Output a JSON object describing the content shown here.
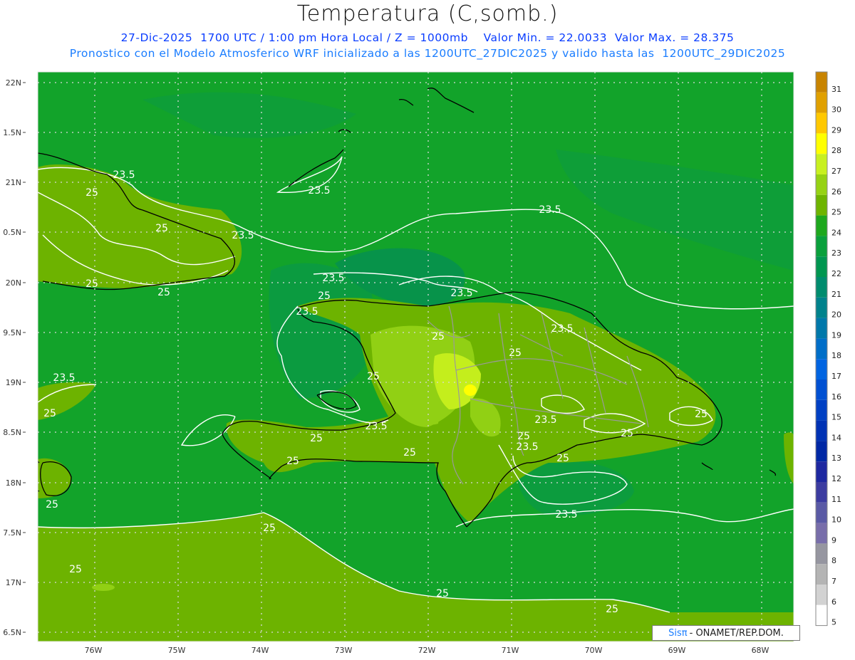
{
  "header": {
    "title": "Temperatura (C,somb.)",
    "subtitle_line1": "27-Dic-2025  1700 UTC / 1:00 pm Hora Local / Z = 1000mb    Valor Min. = 22.0033  Valor Max. = 28.375",
    "subtitle_line2": "Pronostico con el Modelo Atmosferico WRF inicializado a las 1200UTC_27DIC2025 y valido hasta las  1200UTC_29DIC2025"
  },
  "map": {
    "lat_labels": [
      "22N",
      "1.5N",
      "21N",
      "0.5N",
      "20N",
      "9.5N",
      "19N",
      "8.5N",
      "18N",
      "7.5N",
      "17N",
      "6.5N"
    ],
    "lon_labels": [
      "76W",
      "75W",
      "74W",
      "73W",
      "72W",
      "71W",
      "70W",
      "69W",
      "68W"
    ],
    "contour_labels": [
      {
        "text": "23.5",
        "id": "north-cuba"
      },
      {
        "text": "25",
        "id": "cuba-west"
      },
      {
        "text": "25",
        "id": "cuba-mid"
      },
      {
        "text": "23.5",
        "id": "cuba-east"
      },
      {
        "text": "25",
        "id": "cuba-south-1"
      },
      {
        "text": "25",
        "id": "cuba-south-2"
      },
      {
        "text": "23.5",
        "id": "great-inagua"
      },
      {
        "text": "23.5",
        "id": "atlantic-northeast"
      },
      {
        "text": "23.5",
        "id": "tortuga"
      },
      {
        "text": "25",
        "id": "nw-haiti"
      },
      {
        "text": "23.5",
        "id": "haiti-gulf-north"
      },
      {
        "text": "23.5",
        "id": "dr-north-coast"
      },
      {
        "text": "25",
        "id": "haiti-central"
      },
      {
        "text": "25",
        "id": "dr-cordillera"
      },
      {
        "text": "23.5",
        "id": "dr-northeast"
      },
      {
        "text": "25",
        "id": "haiti-west-center"
      },
      {
        "text": "23.5",
        "id": "windward-passage"
      },
      {
        "text": "25",
        "id": "jamaica"
      },
      {
        "text": "23.5",
        "id": "gonave"
      },
      {
        "text": "25",
        "id": "tiburon-north"
      },
      {
        "text": "25",
        "id": "tiburon-south"
      },
      {
        "text": "25",
        "id": "haiti-south-center"
      },
      {
        "text": "23.5",
        "id": "dr-central"
      },
      {
        "text": "25",
        "id": "dr-south"
      },
      {
        "text": "23.5",
        "id": "dr-south-2"
      },
      {
        "text": "25",
        "id": "dr-southeast"
      },
      {
        "text": "25",
        "id": "dr-east"
      },
      {
        "text": "25",
        "id": "dr-east-2"
      },
      {
        "text": "23.5",
        "id": "pedernales-offshore"
      },
      {
        "text": "25",
        "id": "jamaica-south"
      },
      {
        "text": "25",
        "id": "caribbean-central"
      },
      {
        "text": "25",
        "id": "caribbean-west"
      },
      {
        "text": "25",
        "id": "caribbean-south"
      },
      {
        "text": "25",
        "id": "caribbean-southeast"
      }
    ]
  },
  "colorbar": {
    "labels": [
      "31",
      "30",
      "29",
      "28",
      "27",
      "26",
      "25",
      "24",
      "23",
      "22",
      "21",
      "20",
      "19",
      "18",
      "17",
      "16",
      "15",
      "14",
      "13",
      "12",
      "11",
      "10",
      "9",
      "8",
      "7",
      "6",
      "5"
    ],
    "colors": [
      "#c88400",
      "#e0a000",
      "#ffc800",
      "#ffff00",
      "#c8f020",
      "#96d214",
      "#6eb400",
      "#1ea81e",
      "#0aa03c",
      "#009650",
      "#008c6e",
      "#00828c",
      "#0078aa",
      "#006ec8",
      "#0064e1",
      "#0050d2",
      "#0040c3",
      "#0032b4",
      "#0028a5",
      "#1e28a0",
      "#3c3ca0",
      "#5a5aa5",
      "#786eaa",
      "#9696a0",
      "#b4b4b4",
      "#d2d2d2",
      "#ffffff"
    ]
  },
  "credit": {
    "brand": "Sisπ",
    "org": "- ONAMET/REP.DOM."
  }
}
